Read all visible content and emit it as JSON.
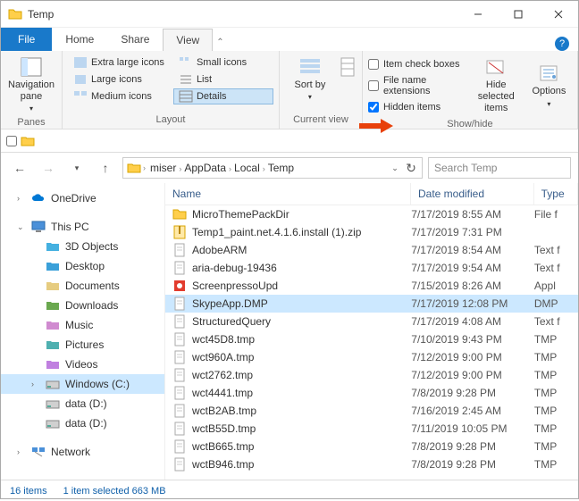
{
  "window": {
    "title": "Temp"
  },
  "tabs": {
    "file": "File",
    "home": "Home",
    "share": "Share",
    "view": "View"
  },
  "ribbon": {
    "panes": {
      "nav_pane": "Navigation pane",
      "label": "Panes"
    },
    "layout": {
      "label": "Layout",
      "items": [
        {
          "name": "Extra large icons"
        },
        {
          "name": "Large icons"
        },
        {
          "name": "Medium icons"
        },
        {
          "name": "Small icons"
        },
        {
          "name": "List"
        },
        {
          "name": "Details"
        }
      ]
    },
    "currentview": {
      "sort_by": "Sort by",
      "label": "Current view"
    },
    "showhide": {
      "label": "Show/hide",
      "item_cb": "Item check boxes",
      "file_ext": "File name extensions",
      "hidden": "Hidden items",
      "hide_sel": "Hide selected items",
      "options": "Options"
    }
  },
  "breadcrumb": [
    "miser",
    "AppData",
    "Local",
    "Temp"
  ],
  "search_placeholder": "Search Temp",
  "sidebar": {
    "onedrive": "OneDrive",
    "thispc": "This PC",
    "items": [
      "3D Objects",
      "Desktop",
      "Documents",
      "Downloads",
      "Music",
      "Pictures",
      "Videos",
      "Windows (C:)",
      "data (D:)",
      "data (D:)"
    ],
    "network": "Network"
  },
  "columns": {
    "name": "Name",
    "date": "Date modified",
    "type": "Type"
  },
  "files": [
    {
      "icon": "folder",
      "name": "MicroThemePackDir",
      "date": "7/17/2019 8:55 AM",
      "type": "File f"
    },
    {
      "icon": "zip",
      "name": "Temp1_paint.net.4.1.6.install (1).zip",
      "date": "7/17/2019 7:31 PM",
      "type": ""
    },
    {
      "icon": "file",
      "name": "AdobeARM",
      "date": "7/17/2019 8:54 AM",
      "type": "Text f"
    },
    {
      "icon": "file",
      "name": "aria-debug-19436",
      "date": "7/17/2019 9:54 AM",
      "type": "Text f"
    },
    {
      "icon": "app",
      "name": "ScreenpressoUpd",
      "date": "7/15/2019 8:26 AM",
      "type": "Appl"
    },
    {
      "icon": "file",
      "name": "SkypeApp.DMP",
      "date": "7/17/2019 12:08 PM",
      "type": "DMP",
      "sel": true
    },
    {
      "icon": "file",
      "name": "StructuredQuery",
      "date": "7/17/2019 4:08 AM",
      "type": "Text f"
    },
    {
      "icon": "file",
      "name": "wct45D8.tmp",
      "date": "7/10/2019 9:43 PM",
      "type": "TMP"
    },
    {
      "icon": "file",
      "name": "wct960A.tmp",
      "date": "7/12/2019 9:00 PM",
      "type": "TMP"
    },
    {
      "icon": "file",
      "name": "wct2762.tmp",
      "date": "7/12/2019 9:00 PM",
      "type": "TMP"
    },
    {
      "icon": "file",
      "name": "wct4441.tmp",
      "date": "7/8/2019 9:28 PM",
      "type": "TMP"
    },
    {
      "icon": "file",
      "name": "wctB2AB.tmp",
      "date": "7/16/2019 2:45 AM",
      "type": "TMP"
    },
    {
      "icon": "file",
      "name": "wctB55D.tmp",
      "date": "7/11/2019 10:05 PM",
      "type": "TMP"
    },
    {
      "icon": "file",
      "name": "wctB665.tmp",
      "date": "7/8/2019 9:28 PM",
      "type": "TMP"
    },
    {
      "icon": "file",
      "name": "wctB946.tmp",
      "date": "7/8/2019 9:28 PM",
      "type": "TMP"
    }
  ],
  "status": {
    "count": "16 items",
    "selection": "1 item selected   663 MB"
  }
}
